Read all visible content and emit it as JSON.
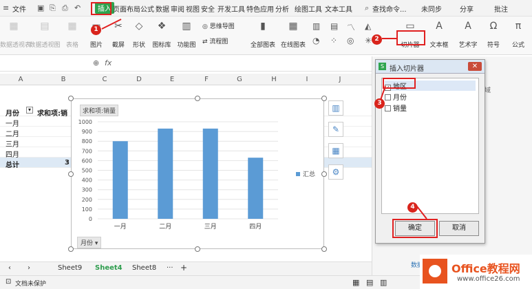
{
  "menubar": {
    "file": "文件",
    "tabs": [
      "插入",
      "页面布局",
      "公式",
      "数据",
      "审阅",
      "视图",
      "安全",
      "开发工具",
      "特色应用",
      "分析",
      "绘图工具",
      "文本工具"
    ],
    "active_tab": "插入",
    "search": "查找命令...",
    "sync": "未同步",
    "share": "分享",
    "comment": "批注"
  },
  "ribbon": {
    "items": [
      {
        "label": "数据透视表",
        "icon": "pivot-table-icon",
        "faded": true
      },
      {
        "label": "数据透视图",
        "icon": "pivot-chart-icon",
        "faded": true
      },
      {
        "label": "表格",
        "icon": "table-icon",
        "faded": true
      },
      {
        "label": "图片",
        "icon": "picture-icon"
      },
      {
        "label": "截屏",
        "icon": "screenshot-icon"
      },
      {
        "label": "形状",
        "icon": "shape-icon"
      },
      {
        "label": "图标库",
        "icon": "icon-library-icon"
      },
      {
        "label": "功能图",
        "icon": "function-chart-icon"
      },
      {
        "label": "思维导图",
        "icon": "mindmap-icon"
      },
      {
        "label": "流程图",
        "icon": "flowchart-icon"
      },
      {
        "label": "全部图表",
        "icon": "all-charts-icon"
      },
      {
        "label": "在线图表",
        "icon": "online-chart-icon"
      },
      {
        "label": "切片器",
        "icon": "slicer-icon"
      },
      {
        "label": "文本框",
        "icon": "textbox-icon"
      },
      {
        "label": "艺术字",
        "icon": "wordart-icon"
      },
      {
        "label": "符号",
        "icon": "symbol-icon"
      },
      {
        "label": "公式",
        "icon": "formula-icon"
      }
    ]
  },
  "formula": {
    "fx": "fx"
  },
  "columns": [
    "A",
    "B",
    "C",
    "D",
    "E",
    "F",
    "G",
    "H",
    "I",
    "J"
  ],
  "sheet": {
    "header": {
      "a": "月份",
      "b": "求和项:销"
    },
    "rows": [
      "一月",
      "二月",
      "三月",
      "四月"
    ],
    "total_label": "总计",
    "total_value": "3"
  },
  "chart": {
    "tag": "求和项:销量",
    "field_button": "月份",
    "legend": "汇总"
  },
  "chart_data": {
    "type": "bar",
    "categories": [
      "一月",
      "二月",
      "三月",
      "四月"
    ],
    "series": [
      {
        "name": "汇总",
        "values": [
          800,
          930,
          930,
          630
        ]
      }
    ],
    "ylim": [
      0,
      1000
    ],
    "yticks": [
      0,
      100,
      200,
      300,
      400,
      500,
      600,
      700,
      800,
      900,
      1000
    ],
    "grid": true,
    "legend_position": "right",
    "color": "#5b9bd5"
  },
  "dialog": {
    "title": "插入切片器",
    "items": [
      {
        "label": "地区",
        "checked": true
      },
      {
        "label": "月份",
        "checked": false
      },
      {
        "label": "销量",
        "checked": false
      }
    ],
    "ok": "确定",
    "cancel": "取消"
  },
  "taskpane": {
    "text1": "域",
    "text2": "数据"
  },
  "sheets": {
    "tabs": [
      "Sheet9",
      "Sheet4",
      "Sheet8"
    ],
    "active": "Sheet4",
    "more": "···",
    "add": "+"
  },
  "status": {
    "doc": "文档未保护"
  },
  "annotations": [
    "1",
    "2",
    "3",
    "4"
  ],
  "watermark": {
    "brand": "Office教程网",
    "url": "www.office26.com"
  }
}
